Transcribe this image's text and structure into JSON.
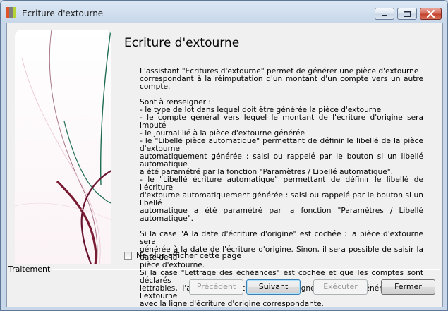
{
  "window": {
    "title": "Ecriture d'extourne"
  },
  "page": {
    "heading": "Ecriture d'extourne",
    "intro": [
      "L'assistant \"Ecritures d'extourne\" permet de générer une pièce d'extourne",
      "correspondant à la réimputation d'un montant d'un compte vers un autre compte."
    ],
    "fields": [
      "Sont à renseigner :",
      "- le type de lot dans lequel doit être générée la pièce d'extourne",
      "- le compte général vers lequel le montant de l'écriture d'origine sera imputé",
      "- le journal lié à la pièce d'extourne générée",
      "- le \"Libellé pièce automatique\" permettant de définir le libellé de la pièce d'extourne",
      "automatiquement générée : saisi ou rappelé par le bouton si un libellé automatique",
      "a été paramétré par la fonction \"Paramètres / Libellé automatique\".",
      "- le \"Libellé écriture automatique\" permettant de définir le libellé de l'écriture",
      "d'extourne automatiquement générée : saisi ou rappelé par le bouton si un libellé",
      "automatique a été paramétré par la fonction \"Paramètres / Libellé automatique\"."
    ],
    "notes": [
      "Si la case \"A la date d'écriture d'origine\" est cochée : la pièce d'extourne sera",
      "générée à la date de l'écriture d'origine. Sinon, il sera possible de saisir la date de la",
      "pièce d'extourne.",
      "Si la case \"Lettrage des échéances\" est cochée et que les comptes sont déclarés",
      "lettrables, l'application lettrera chaque ligne d'écriture générée suite à l'extourne",
      "avec la ligne d'écriture d'origine correspondante."
    ],
    "dont_show_label": "Ne plus afficher cette page",
    "group_label": "Traitement"
  },
  "buttons": {
    "previous": "Précédent",
    "next": "Suivant",
    "execute": "Exécuter",
    "close": "Fermer"
  }
}
